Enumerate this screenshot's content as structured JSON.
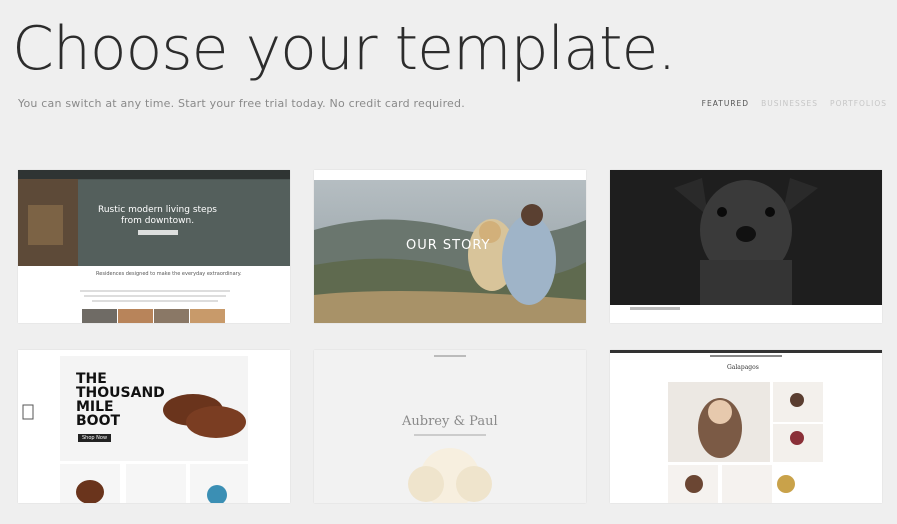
{
  "header": {
    "title": "Choose your template.",
    "subtitle": "You can switch at any time. Start your free trial today. No credit card required."
  },
  "filters": [
    {
      "label": "FEATURED",
      "active": true
    },
    {
      "label": "BUSINESSES",
      "active": false
    },
    {
      "label": "PORTFOLIOS",
      "active": false
    }
  ],
  "templates": {
    "t1": {
      "hero_line1": "Rustic modern living steps",
      "hero_line2": "from downtown.",
      "tagline": "Residences designed to make the everyday extraordinary."
    },
    "t2": {
      "hero": "OUR STORY"
    },
    "t4": {
      "headline_1": "THE",
      "headline_2": "THOUSAND",
      "headline_3": "MILE",
      "headline_4": "BOOT",
      "cta": "Shop Now"
    },
    "t5": {
      "names": "Aubrey & Paul"
    },
    "t6": {
      "brand": "Galapagos"
    }
  }
}
